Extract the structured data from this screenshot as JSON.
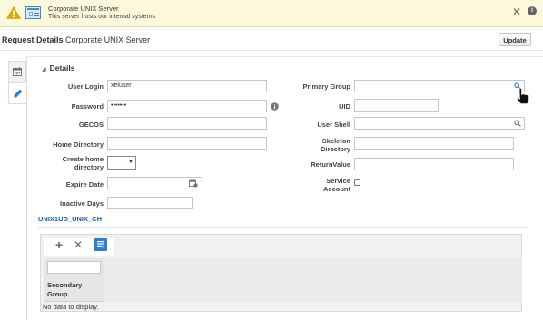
{
  "banner": {
    "title": "Corporate UNIX Server",
    "subtitle": "This server hosts our internal systems",
    "close_icon": "close-icon",
    "info_icon": "info-icon",
    "warning_icon": "warning-icon",
    "info_glyph": "i",
    "colors": {
      "background": "#fcf8dc",
      "warning": "#e6a700"
    }
  },
  "header": {
    "title_bold": "Request Details",
    "title_rest": "Corporate UNIX Server",
    "update_label": "Update"
  },
  "tabs": [
    {
      "icon": "calendar-icon",
      "selected": false
    },
    {
      "icon": "pencil-icon",
      "selected": true
    }
  ],
  "section": {
    "title": "Details",
    "toggle_icon": "collapse-triangle-icon"
  },
  "form": {
    "user_login": {
      "label": "User Login",
      "value": "xeluser"
    },
    "password": {
      "label": "Password",
      "value": "•••••••"
    },
    "gecos": {
      "label": "GECOS",
      "value": ""
    },
    "home_directory": {
      "label": "Home Directory",
      "value": ""
    },
    "create_home_directory": {
      "label": "Create home directory",
      "value": ""
    },
    "expire_date": {
      "label": "Expire Date",
      "value": ""
    },
    "inactive_days": {
      "label": "Inactive Days",
      "value": ""
    },
    "primary_group": {
      "label": "Primary Group",
      "value": ""
    },
    "uid": {
      "label": "UID",
      "value": ""
    },
    "user_shell": {
      "label": "User Shell",
      "value": ""
    },
    "skeleton_directory": {
      "label": "Skeleton Directory",
      "value": ""
    },
    "return_value": {
      "label": "ReturnValue",
      "value": ""
    },
    "service_account": {
      "label": "Service Account",
      "checked": false
    }
  },
  "child_form": {
    "link": "UNIX1UD_UNIX_CH",
    "toolbar": {
      "add_icon": "plus-icon",
      "delete_icon": "delete-icon",
      "detach_icon": "detach-icon"
    },
    "columns": [
      "Secondary Group"
    ],
    "empty_text": "No data to display."
  },
  "colors": {
    "link": "#1a5fa3",
    "accent": "#2f7fcd"
  }
}
